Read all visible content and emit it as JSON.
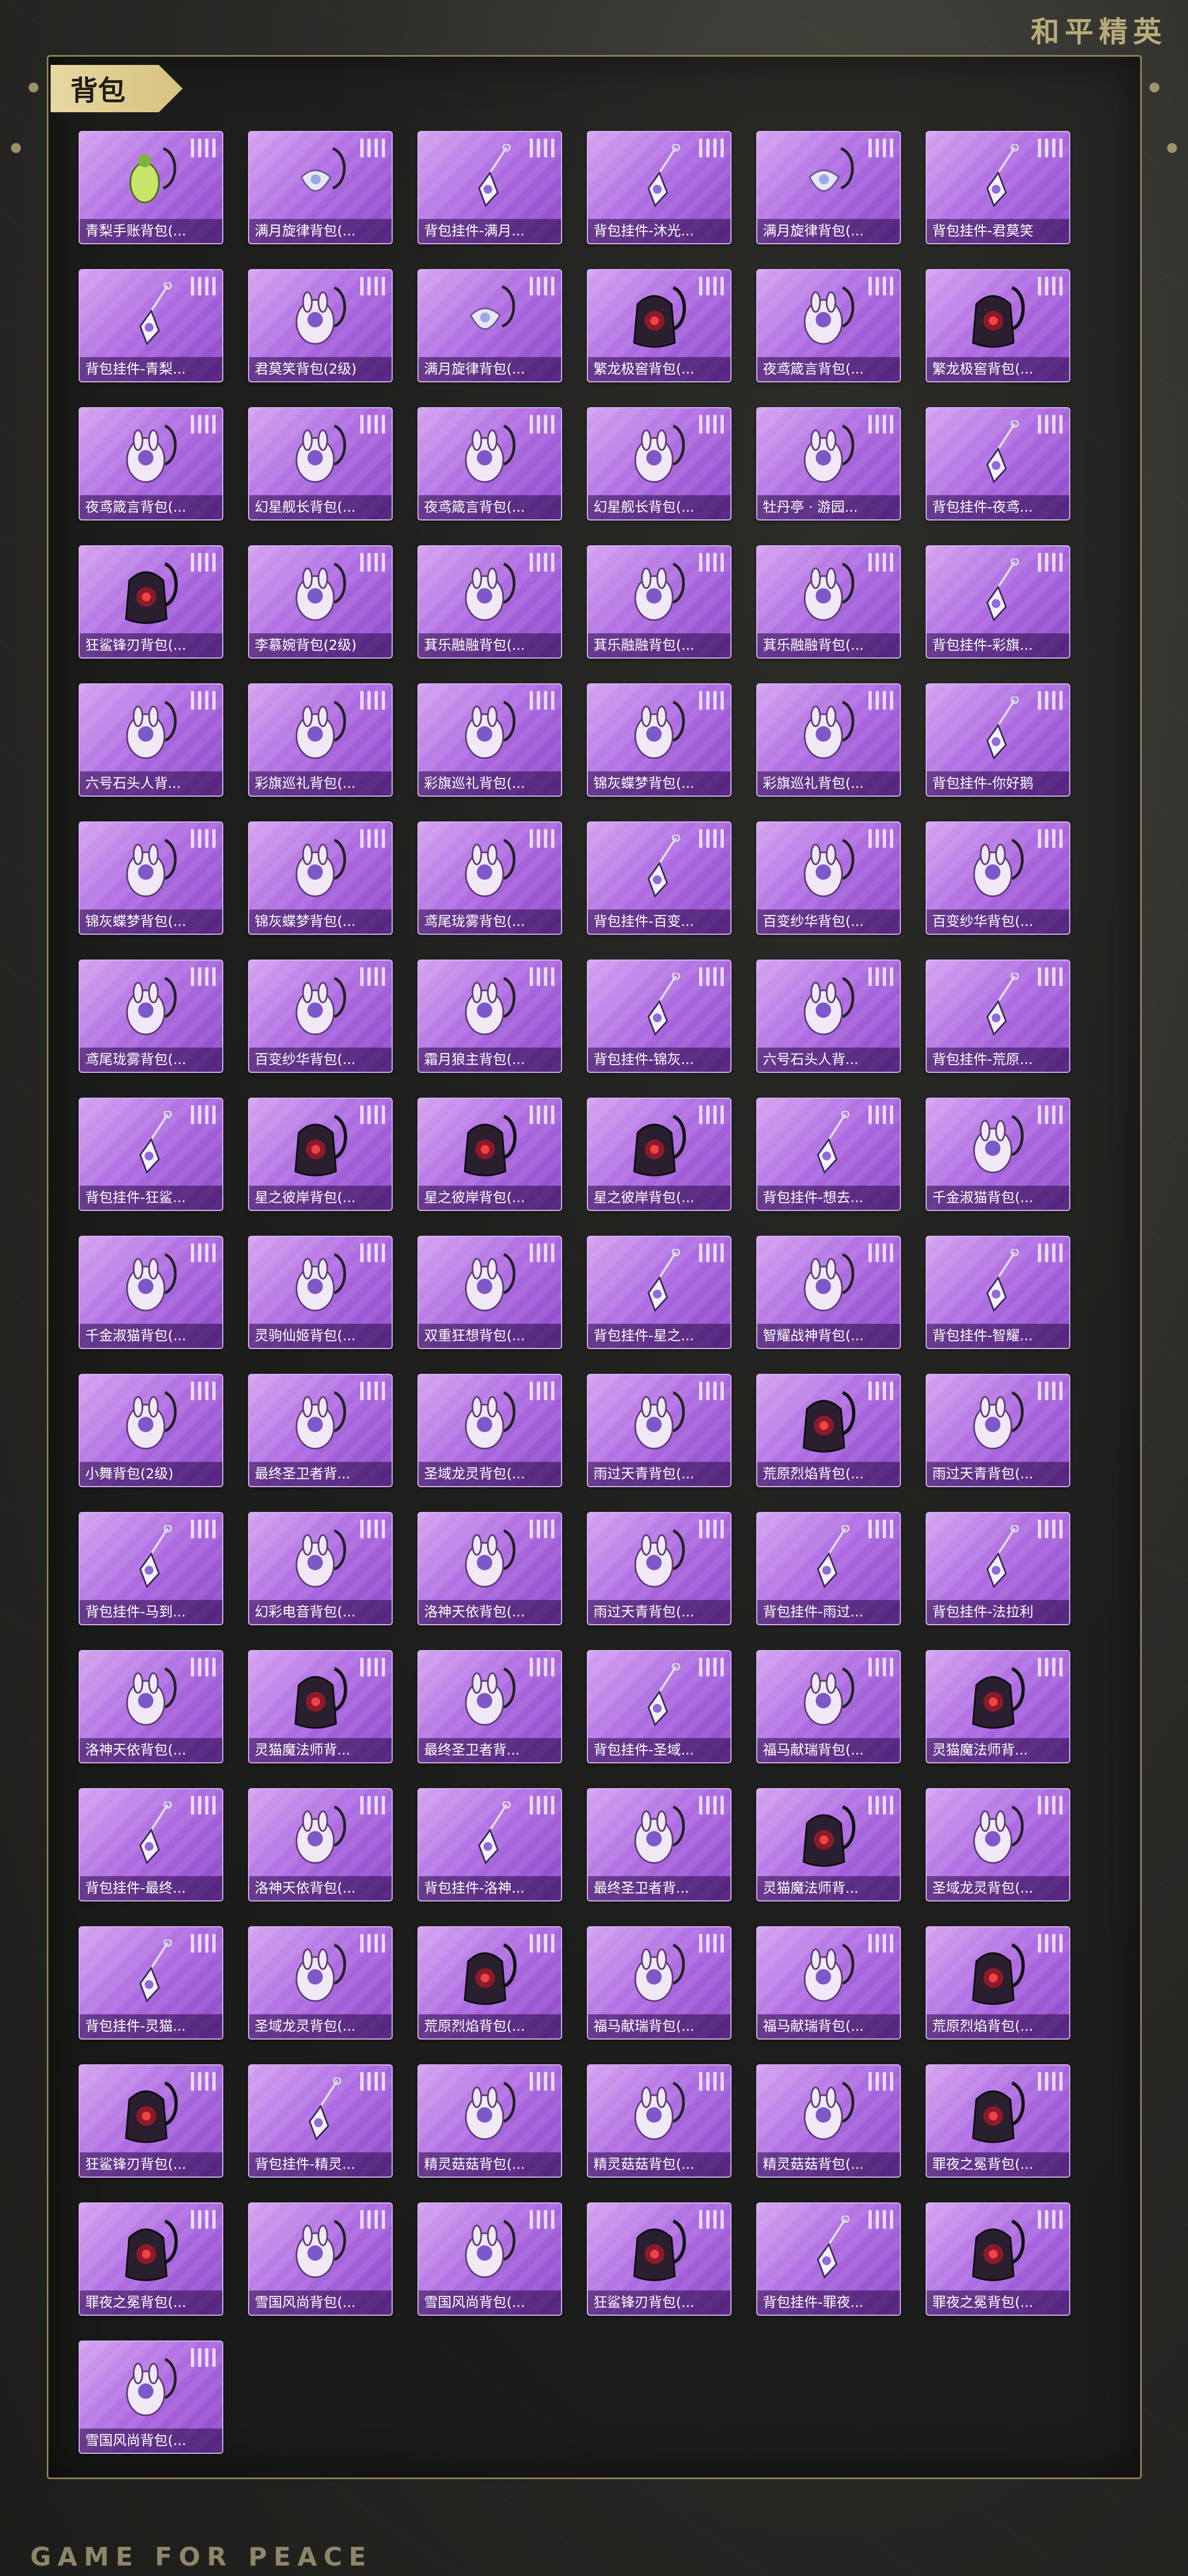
{
  "brand": "和平精英",
  "footer_brand": "GAME FOR PEACE",
  "section_title": "背包",
  "items": [
    {
      "label": "青梨手账背包(...",
      "icon": "green-pendant"
    },
    {
      "label": "满月旋律背包(...",
      "icon": "moon-pendant"
    },
    {
      "label": "背包挂件-满月...",
      "icon": "charm"
    },
    {
      "label": "背包挂件-沐光...",
      "icon": "charm"
    },
    {
      "label": "满月旋律背包(...",
      "icon": "moon-pendant"
    },
    {
      "label": "背包挂件-君莫笑",
      "icon": "charm"
    },
    {
      "label": "背包挂件-青梨...",
      "icon": "charm"
    },
    {
      "label": "君莫笑背包(2级)",
      "icon": "backpack"
    },
    {
      "label": "满月旋律背包(...",
      "icon": "moon-pendant"
    },
    {
      "label": "繁龙极窖背包(...",
      "icon": "dark-backpack"
    },
    {
      "label": "夜鸢箴言背包(...",
      "icon": "backpack"
    },
    {
      "label": "繁龙极窖背包(...",
      "icon": "dark-backpack"
    },
    {
      "label": "夜鸢箴言背包(...",
      "icon": "backpack"
    },
    {
      "label": "幻星舰长背包(...",
      "icon": "backpack"
    },
    {
      "label": "夜鸢箴言背包(...",
      "icon": "backpack"
    },
    {
      "label": "幻星舰长背包(...",
      "icon": "backpack"
    },
    {
      "label": "牡丹亭 · 游园...",
      "icon": "backpack"
    },
    {
      "label": "背包挂件-夜鸢...",
      "icon": "charm"
    },
    {
      "label": "狂鲨锋刃背包(...",
      "icon": "dark-backpack"
    },
    {
      "label": "李慕婉背包(2级)",
      "icon": "backpack"
    },
    {
      "label": "萁乐融融背包(...",
      "icon": "backpack"
    },
    {
      "label": "萁乐融融背包(...",
      "icon": "backpack"
    },
    {
      "label": "萁乐融融背包(...",
      "icon": "backpack"
    },
    {
      "label": "背包挂件-彩旗...",
      "icon": "charm"
    },
    {
      "label": "六号石头人背...",
      "icon": "backpack"
    },
    {
      "label": "彩旗巡礼背包(...",
      "icon": "backpack"
    },
    {
      "label": "彩旗巡礼背包(...",
      "icon": "backpack"
    },
    {
      "label": "锦灰蝶梦背包(...",
      "icon": "backpack"
    },
    {
      "label": "彩旗巡礼背包(...",
      "icon": "backpack"
    },
    {
      "label": "背包挂件-你好鹅",
      "icon": "charm"
    },
    {
      "label": "锦灰蝶梦背包(...",
      "icon": "backpack"
    },
    {
      "label": "锦灰蝶梦背包(...",
      "icon": "backpack"
    },
    {
      "label": "鸢尾珑雾背包(...",
      "icon": "backpack"
    },
    {
      "label": "背包挂件-百变...",
      "icon": "charm"
    },
    {
      "label": "百变纱华背包(...",
      "icon": "backpack"
    },
    {
      "label": "百变纱华背包(...",
      "icon": "backpack"
    },
    {
      "label": "鸢尾珑雾背包(...",
      "icon": "backpack"
    },
    {
      "label": "百变纱华背包(...",
      "icon": "backpack"
    },
    {
      "label": "霜月狼主背包(...",
      "icon": "backpack"
    },
    {
      "label": "背包挂件-锦灰...",
      "icon": "charm"
    },
    {
      "label": "六号石头人背...",
      "icon": "backpack"
    },
    {
      "label": "背包挂件-荒原...",
      "icon": "charm"
    },
    {
      "label": "背包挂件-狂鲨...",
      "icon": "charm"
    },
    {
      "label": "星之彼岸背包(...",
      "icon": "dark-backpack"
    },
    {
      "label": "星之彼岸背包(...",
      "icon": "dark-backpack"
    },
    {
      "label": "星之彼岸背包(...",
      "icon": "dark-backpack"
    },
    {
      "label": "背包挂件-想去...",
      "icon": "charm"
    },
    {
      "label": "千金淑猫背包(...",
      "icon": "backpack"
    },
    {
      "label": "千金淑猫背包(...",
      "icon": "backpack"
    },
    {
      "label": "灵驹仙姬背包(...",
      "icon": "backpack"
    },
    {
      "label": "双重狂想背包(...",
      "icon": "backpack"
    },
    {
      "label": "背包挂件-星之...",
      "icon": "charm"
    },
    {
      "label": "智耀战神背包(...",
      "icon": "backpack"
    },
    {
      "label": "背包挂件-智耀...",
      "icon": "charm"
    },
    {
      "label": "小舞背包(2级)",
      "icon": "backpack"
    },
    {
      "label": "最终圣卫者背...",
      "icon": "backpack"
    },
    {
      "label": "圣域龙灵背包(...",
      "icon": "backpack"
    },
    {
      "label": "雨过天青背包(...",
      "icon": "backpack"
    },
    {
      "label": "荒原烈焰背包(...",
      "icon": "dark-backpack"
    },
    {
      "label": "雨过天青背包(...",
      "icon": "backpack"
    },
    {
      "label": "背包挂件-马到...",
      "icon": "charm"
    },
    {
      "label": "幻彩电音背包(...",
      "icon": "backpack"
    },
    {
      "label": "洛神天依背包(...",
      "icon": "backpack"
    },
    {
      "label": "雨过天青背包(...",
      "icon": "backpack"
    },
    {
      "label": "背包挂件-雨过...",
      "icon": "charm"
    },
    {
      "label": "背包挂件-法拉利",
      "icon": "charm"
    },
    {
      "label": "洛神天依背包(...",
      "icon": "backpack"
    },
    {
      "label": "灵猫魔法师背...",
      "icon": "dark-backpack"
    },
    {
      "label": "最终圣卫者背...",
      "icon": "backpack"
    },
    {
      "label": "背包挂件-圣域...",
      "icon": "charm"
    },
    {
      "label": "福马献瑞背包(...",
      "icon": "backpack"
    },
    {
      "label": "灵猫魔法师背...",
      "icon": "dark-backpack"
    },
    {
      "label": "背包挂件-最终...",
      "icon": "charm"
    },
    {
      "label": "洛神天依背包(...",
      "icon": "backpack"
    },
    {
      "label": "背包挂件-洛神...",
      "icon": "charm"
    },
    {
      "label": "最终圣卫者背...",
      "icon": "backpack"
    },
    {
      "label": "灵猫魔法师背...",
      "icon": "dark-backpack"
    },
    {
      "label": "圣域龙灵背包(...",
      "icon": "backpack"
    },
    {
      "label": "背包挂件-灵猫...",
      "icon": "charm"
    },
    {
      "label": "圣域龙灵背包(...",
      "icon": "backpack"
    },
    {
      "label": "荒原烈焰背包(...",
      "icon": "dark-backpack"
    },
    {
      "label": "福马献瑞背包(...",
      "icon": "backpack"
    },
    {
      "label": "福马献瑞背包(...",
      "icon": "backpack"
    },
    {
      "label": "荒原烈焰背包(...",
      "icon": "dark-backpack"
    },
    {
      "label": "狂鲨锋刃背包(...",
      "icon": "dark-backpack"
    },
    {
      "label": "背包挂件-精灵...",
      "icon": "charm"
    },
    {
      "label": "精灵菇菇背包(...",
      "icon": "backpack"
    },
    {
      "label": "精灵菇菇背包(...",
      "icon": "backpack"
    },
    {
      "label": "精灵菇菇背包(...",
      "icon": "backpack"
    },
    {
      "label": "罪夜之冕背包(...",
      "icon": "dark-backpack"
    },
    {
      "label": "罪夜之冕背包(...",
      "icon": "dark-backpack"
    },
    {
      "label": "雪国风尚背包(...",
      "icon": "backpack"
    },
    {
      "label": "雪国风尚背包(...",
      "icon": "backpack"
    },
    {
      "label": "狂鲨锋刃背包(...",
      "icon": "dark-backpack"
    },
    {
      "label": "背包挂件-罪夜...",
      "icon": "charm"
    },
    {
      "label": "罪夜之冕背包(...",
      "icon": "dark-backpack"
    },
    {
      "label": "雪国风尚背包(...",
      "icon": "backpack"
    }
  ]
}
